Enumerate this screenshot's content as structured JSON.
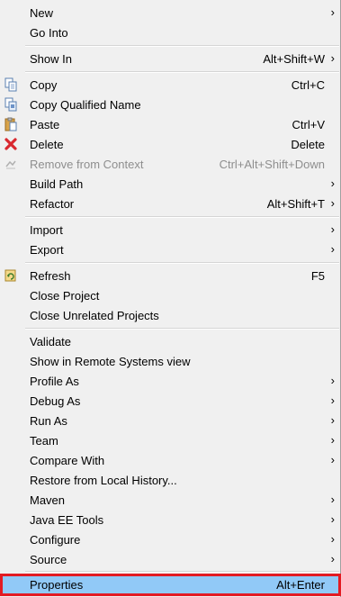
{
  "menu": {
    "new": {
      "label": "New",
      "arrow": "›"
    },
    "go_into": {
      "label": "Go Into"
    },
    "show_in": {
      "label": "Show In",
      "shortcut": "Alt+Shift+W",
      "arrow": "›"
    },
    "copy": {
      "label": "Copy",
      "shortcut": "Ctrl+C",
      "icon": "copy-icon"
    },
    "copy_qualified": {
      "label": "Copy Qualified Name",
      "icon": "copy-qualified-icon"
    },
    "paste": {
      "label": "Paste",
      "shortcut": "Ctrl+V",
      "icon": "paste-icon"
    },
    "delete": {
      "label": "Delete",
      "shortcut": "Delete",
      "icon": "delete-icon",
      "icon_color": "#d9282f"
    },
    "remove_context": {
      "label": "Remove from Context",
      "shortcut": "Ctrl+Alt+Shift+Down",
      "icon": "remove-context-icon",
      "disabled": true
    },
    "build_path": {
      "label": "Build Path",
      "arrow": "›"
    },
    "refactor": {
      "label": "Refactor",
      "shortcut": "Alt+Shift+T",
      "arrow": "›"
    },
    "import": {
      "label": "Import",
      "arrow": "›"
    },
    "export": {
      "label": "Export",
      "arrow": "›"
    },
    "refresh": {
      "label": "Refresh",
      "shortcut": "F5",
      "icon": "refresh-icon"
    },
    "close_project": {
      "label": "Close Project"
    },
    "close_unrelated": {
      "label": "Close Unrelated Projects"
    },
    "validate": {
      "label": "Validate"
    },
    "show_remote": {
      "label": "Show in Remote Systems view"
    },
    "profile_as": {
      "label": "Profile As",
      "arrow": "›"
    },
    "debug_as": {
      "label": "Debug As",
      "arrow": "›"
    },
    "run_as": {
      "label": "Run As",
      "arrow": "›"
    },
    "team": {
      "label": "Team",
      "arrow": "›"
    },
    "compare_with": {
      "label": "Compare With",
      "arrow": "›"
    },
    "restore_history": {
      "label": "Restore from Local History..."
    },
    "maven": {
      "label": "Maven",
      "arrow": "›"
    },
    "java_ee_tools": {
      "label": "Java EE Tools",
      "arrow": "›"
    },
    "configure": {
      "label": "Configure",
      "arrow": "›"
    },
    "source": {
      "label": "Source",
      "arrow": "›"
    },
    "properties": {
      "label": "Properties",
      "shortcut": "Alt+Enter"
    }
  },
  "colors": {
    "menu_bg": "#f0f0f0",
    "highlight_bg": "#91c9f7",
    "highlight_border": "#e31b23",
    "disabled_text": "#8e8e8e"
  }
}
